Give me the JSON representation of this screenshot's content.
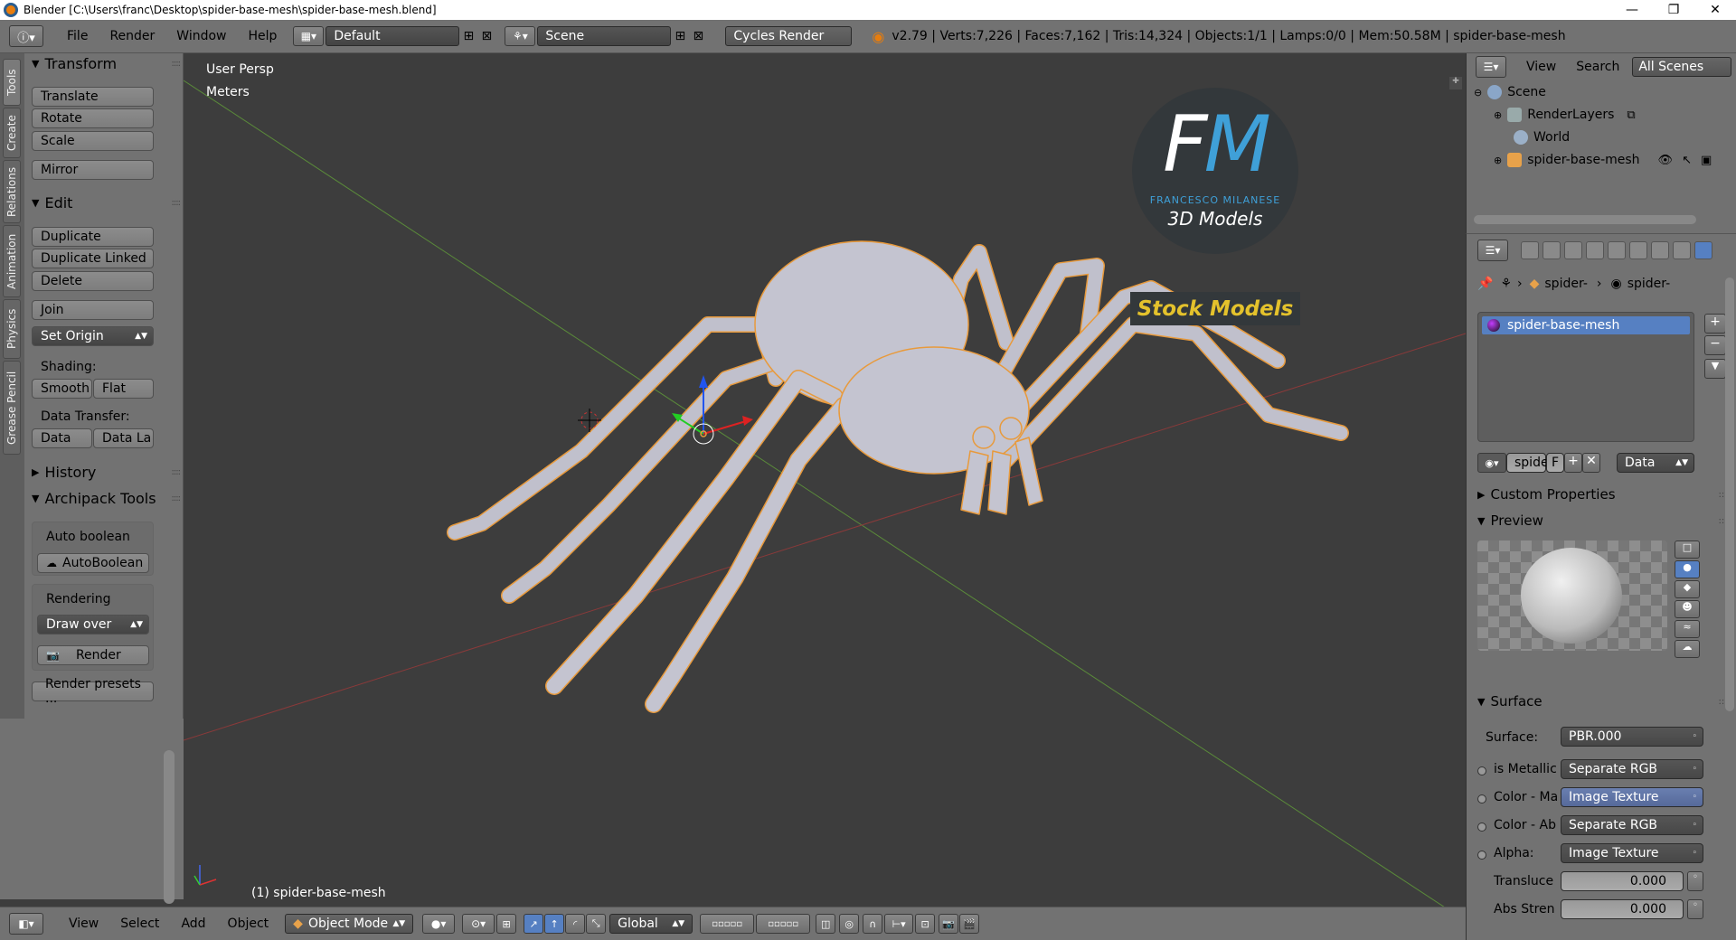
{
  "window": {
    "title": "Blender [C:\\Users\\franc\\Desktop\\spider-base-mesh\\spider-base-mesh.blend]",
    "controls": [
      "—",
      "❐",
      "✕"
    ]
  },
  "infobar": {
    "menus": [
      "File",
      "Render",
      "Window",
      "Help"
    ],
    "layout": "Default",
    "scene": "Scene",
    "engine": "Cycles Render",
    "stats": "v2.79 | Verts:7,226 | Faces:7,162 | Tris:14,324 | Objects:1/1 | Lamps:0/0 | Mem:50.58M | spider-base-mesh"
  },
  "tool_tabs": [
    "Tools",
    "Create",
    "Relations",
    "Animation",
    "Physics",
    "Grease Pencil"
  ],
  "toolshelf": {
    "transform_header": "Transform",
    "translate": "Translate",
    "rotate": "Rotate",
    "scale": "Scale",
    "mirror": "Mirror",
    "edit_header": "Edit",
    "duplicate": "Duplicate",
    "duplicate_linked": "Duplicate Linked",
    "delete": "Delete",
    "join": "Join",
    "set_origin": "Set Origin",
    "shading_label": "Shading:",
    "smooth": "Smooth",
    "flat": "Flat",
    "data_transfer_label": "Data Transfer:",
    "data": "Data",
    "data_la": "Data La",
    "history_header": "History",
    "archipack_header": "Archipack Tools",
    "auto_boolean_label": "Auto boolean",
    "auto_boolean_btn": "AutoBoolean",
    "rendering_label": "Rendering",
    "draw_over": "Draw over",
    "render_btn": "Render",
    "render_presets": "Render presets ..."
  },
  "viewport": {
    "view_name": "User Persp",
    "units": "Meters",
    "object_label": "(1) spider-base-mesh",
    "watermark_initials": "FM",
    "watermark_name": "FRANCESCO MILANESE",
    "watermark_sub": "3D Models",
    "watermark_banner": "Stock Models"
  },
  "bottombar": {
    "menus": [
      "View",
      "Select",
      "Add",
      "Object"
    ],
    "mode": "Object Mode",
    "orientation": "Global"
  },
  "outliner": {
    "header_view": "View",
    "header_search": "Search",
    "header_scenes": "All Scenes",
    "items": [
      "Scene",
      "RenderLayers",
      "World",
      "spider-base-mesh"
    ]
  },
  "properties": {
    "breadcrumb_1": "spider-",
    "breadcrumb_2": "spider-",
    "material_slot": "spider-base-mesh",
    "mat_name": "spide",
    "mat_f": "F",
    "link_type": "Data",
    "custom_props": "Custom Properties",
    "preview": "Preview",
    "surface_header": "Surface",
    "surface_label": "Surface:",
    "surface_value": "PBR.000",
    "inputs": [
      {
        "label": "is Metallic",
        "value": "Separate RGB"
      },
      {
        "label": "Color - Ma",
        "value": "Image Texture"
      },
      {
        "label": "Color - Ab",
        "value": "Separate RGB"
      },
      {
        "label": "Alpha:",
        "value": "Image Texture"
      }
    ],
    "translucence_label": "Transluce",
    "translucence_value": "0.000",
    "abs_strength_label": "Abs Stren",
    "abs_strength_value": "0.000"
  },
  "colors": {
    "accent_blue": "#5680c2",
    "mesh": "#c8c8d4",
    "selection_outline": "#e89a3c",
    "watermark_blue": "#3fa0d8",
    "banner_yellow": "#e4c22c"
  }
}
